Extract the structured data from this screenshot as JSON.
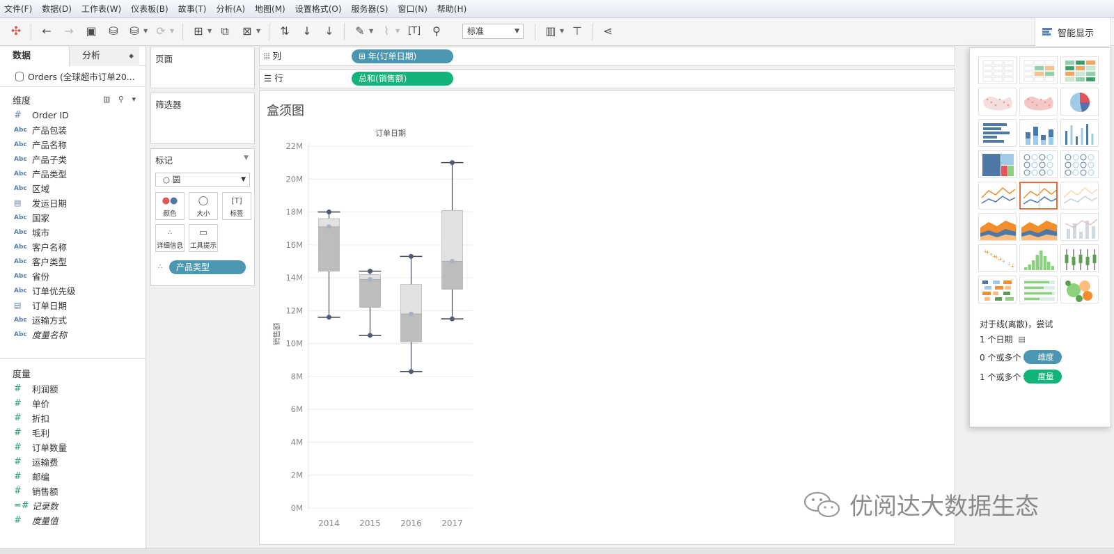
{
  "menu": [
    "文件(F)",
    "数据(D)",
    "工作表(W)",
    "仪表板(B)",
    "故事(T)",
    "分析(A)",
    "地图(M)",
    "设置格式(O)",
    "服务器(S)",
    "窗口(N)",
    "帮助(H)"
  ],
  "toolbar": {
    "fit": "标准",
    "show_me": "智能显示"
  },
  "data_pane": {
    "tab_data": "数据",
    "tab_analysis": "分析",
    "datasource": "Orders (全球超市订单20...",
    "dimensions_header": "维度",
    "dimensions": [
      {
        "type": "#",
        "name": "Order ID"
      },
      {
        "type": "Abc",
        "name": "产品包装"
      },
      {
        "type": "Abc",
        "name": "产品名称"
      },
      {
        "type": "Abc",
        "name": "产品子类"
      },
      {
        "type": "Abc",
        "name": "产品类型"
      },
      {
        "type": "Abc",
        "name": "区域"
      },
      {
        "type": "date",
        "name": "发运日期"
      },
      {
        "type": "Abc",
        "name": "国家"
      },
      {
        "type": "Abc",
        "name": "城市"
      },
      {
        "type": "Abc",
        "name": "客户名称"
      },
      {
        "type": "Abc",
        "name": "客户类型"
      },
      {
        "type": "Abc",
        "name": "省份"
      },
      {
        "type": "Abc",
        "name": "订单优先级"
      },
      {
        "type": "date",
        "name": "订单日期"
      },
      {
        "type": "Abc",
        "name": "运输方式"
      },
      {
        "type": "Abc",
        "name": "度量名称",
        "italic": true
      }
    ],
    "measures_header": "度量",
    "measures": [
      {
        "name": "利润额"
      },
      {
        "name": "单价"
      },
      {
        "name": "折扣"
      },
      {
        "name": "毛利"
      },
      {
        "name": "订单数量"
      },
      {
        "name": "运输费"
      },
      {
        "name": "邮编"
      },
      {
        "name": "销售额"
      },
      {
        "name": "记录数",
        "italic": true
      },
      {
        "name": "度量值",
        "italic": true
      }
    ]
  },
  "cards": {
    "pages": "页面",
    "filters": "筛选器",
    "marks": "标记",
    "mark_type": "圆",
    "mark_buttons": {
      "color": "颜色",
      "size": "大小",
      "label": "标签",
      "detail": "详细信息",
      "tooltip": "工具提示"
    },
    "detail_pill": "产品类型"
  },
  "shelves": {
    "columns_label": "列",
    "columns_pill": "年(订单日期)",
    "rows_label": "行",
    "rows_pill": "总和(销售额)"
  },
  "sheet_title": "盒须图",
  "chart_data": {
    "type": "box",
    "column_header": "订单日期",
    "ylabel": "销售额",
    "categories": [
      "2014",
      "2015",
      "2016",
      "2017"
    ],
    "y_ticks": [
      "0M",
      "2M",
      "4M",
      "6M",
      "8M",
      "10M",
      "12M",
      "14M",
      "16M",
      "18M",
      "20M",
      "22M"
    ],
    "ylim": [
      0,
      22
    ],
    "unit": "M",
    "boxes": [
      {
        "year": "2014",
        "min": 11.6,
        "q1": 14.4,
        "median": 17.1,
        "q3": 17.6,
        "max": 18.0,
        "points": [
          18.0,
          17.1,
          11.6
        ]
      },
      {
        "year": "2015",
        "min": 10.5,
        "q1": 12.2,
        "median": 13.9,
        "q3": 14.2,
        "max": 14.4,
        "points": [
          14.4,
          13.9,
          10.5
        ]
      },
      {
        "year": "2016",
        "min": 8.3,
        "q1": 10.1,
        "median": 11.8,
        "q3": 13.6,
        "max": 15.3,
        "points": [
          15.3,
          11.8,
          8.3
        ]
      },
      {
        "year": "2017",
        "min": 11.5,
        "q1": 13.3,
        "median": 15.0,
        "q3": 18.1,
        "max": 21.0,
        "points": [
          21.0,
          15.0,
          11.5
        ]
      }
    ],
    "colors": {
      "box_lower": "#bdbdbd",
      "box_upper": "#e2e2e2",
      "whisker": "#444a55",
      "point": "#4e5d75",
      "point_light": "#a9b3c4",
      "grid": "#ececec",
      "axis_text": "#888888"
    }
  },
  "show_me": {
    "hint": "对于线(离散)，尝试",
    "req1": "1 个日期",
    "req2_prefix": "0 个或多个",
    "req2_pill": "维度",
    "req3_prefix": "1 个或多个",
    "req3_pill": "度量"
  },
  "watermark": "优阅达大数据生态"
}
